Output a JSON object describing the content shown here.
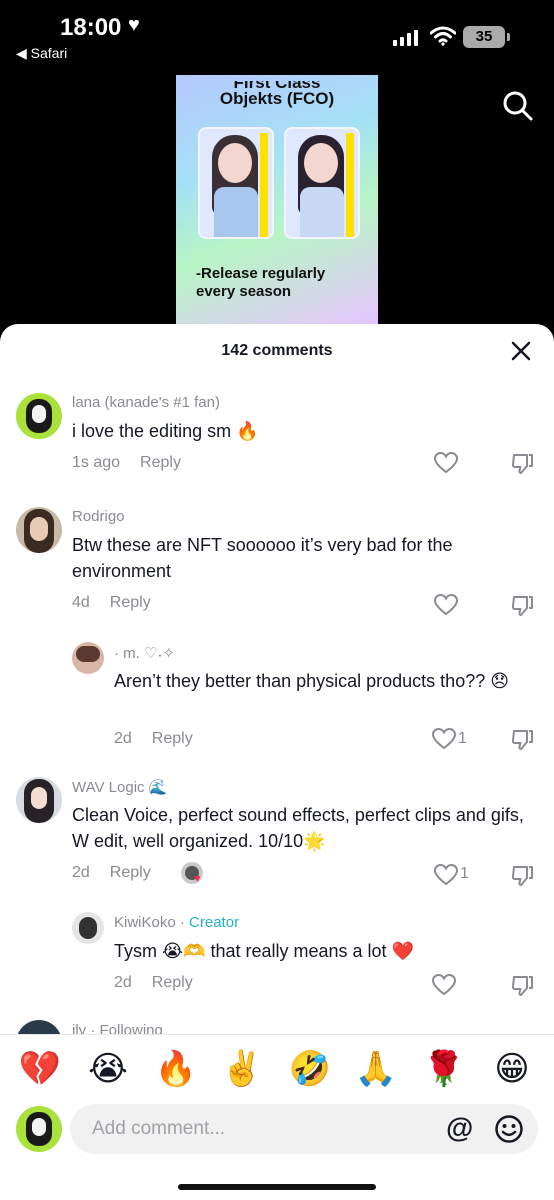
{
  "status_bar": {
    "time": "18:00",
    "back_app": "◀ Safari",
    "battery": "35"
  },
  "video": {
    "title_partial": "First Class",
    "title": "Objekts (FCO)",
    "subtitle_line1": "-Release regularly",
    "subtitle_line2": "every season"
  },
  "comments_header": {
    "title": "142 comments"
  },
  "comments": [
    {
      "author": "lana (kanade's #1 fan)",
      "text": "i love the editing sm 🔥",
      "time": "1s ago",
      "reply": "Reply",
      "likes": ""
    },
    {
      "author": "Rodrigo",
      "text": "Btw these are NFT soooooo it’s very bad for the environment",
      "time": "4d",
      "reply": "Reply",
      "likes": ""
    },
    {
      "author": "· m. ♡˖✧",
      "text": "Aren’t they better than physical products tho?? 😞",
      "time": "2d",
      "reply": "Reply",
      "likes": "1"
    },
    {
      "author": "WAV Logic 🌊",
      "text": "Clean Voice, perfect sound effects, perfect clips and gifs, W edit, well organized. 10/10🌟",
      "time": "2d",
      "reply": "Reply",
      "likes": "1"
    },
    {
      "author": "KiwiKoko",
      "author_badge": "Creator",
      "text": "Tysm 😭🫶 that really means a lot ❤️",
      "time": "2d",
      "reply": "Reply",
      "likes": ""
    },
    {
      "author": "ily · Following"
    }
  ],
  "emoji_bar": [
    "💔",
    "😭",
    "🔥",
    "✌️",
    "🤣",
    "🙏",
    "🌹",
    "😁"
  ],
  "composer": {
    "placeholder": "Add comment...",
    "at_symbol": "@"
  }
}
